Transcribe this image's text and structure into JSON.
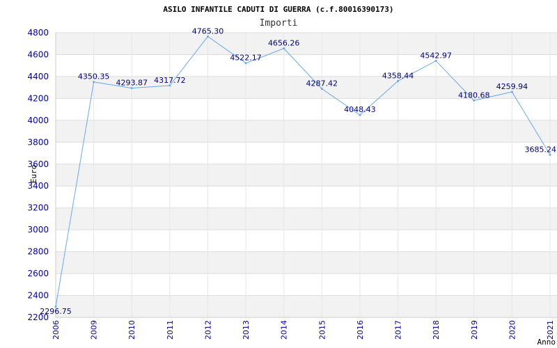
{
  "chart_data": {
    "type": "line",
    "title": "ASILO INFANTILE CADUTI DI GUERRA (c.f.80016390173)",
    "subtitle": "Importi",
    "xlabel": "Anno",
    "ylabel": "Euro",
    "ylim": [
      2200,
      4800
    ],
    "yticks": [
      2200,
      2400,
      2600,
      2800,
      3000,
      3200,
      3400,
      3600,
      3800,
      4000,
      4200,
      4400,
      4600,
      4800
    ],
    "grid": true,
    "line_color": "#66aaee",
    "label_color": "#000080",
    "tick_color": "#0000aa",
    "band_color": "#f2f2f2",
    "categories": [
      "2006",
      "2009",
      "2010",
      "2011",
      "2012",
      "2013",
      "2014",
      "2015",
      "2016",
      "2017",
      "2018",
      "2019",
      "2020",
      "2021"
    ],
    "series": [
      {
        "values": [
          2296.75,
          4350.35,
          4293.87,
          4317.72,
          4765.3,
          4522.17,
          4656.26,
          4287.42,
          4048.43,
          4358.44,
          4542.97,
          4180.68,
          4259.94,
          3685.24
        ],
        "labels": [
          "2296.75",
          "4350.35",
          "4293.87",
          "4317.72",
          "4765.30",
          "4522.17",
          "4656.26",
          "4287.42",
          "4048.43",
          "4358.44",
          "4542.97",
          "4180.68",
          "4259.94",
          "3685.24"
        ]
      }
    ]
  }
}
